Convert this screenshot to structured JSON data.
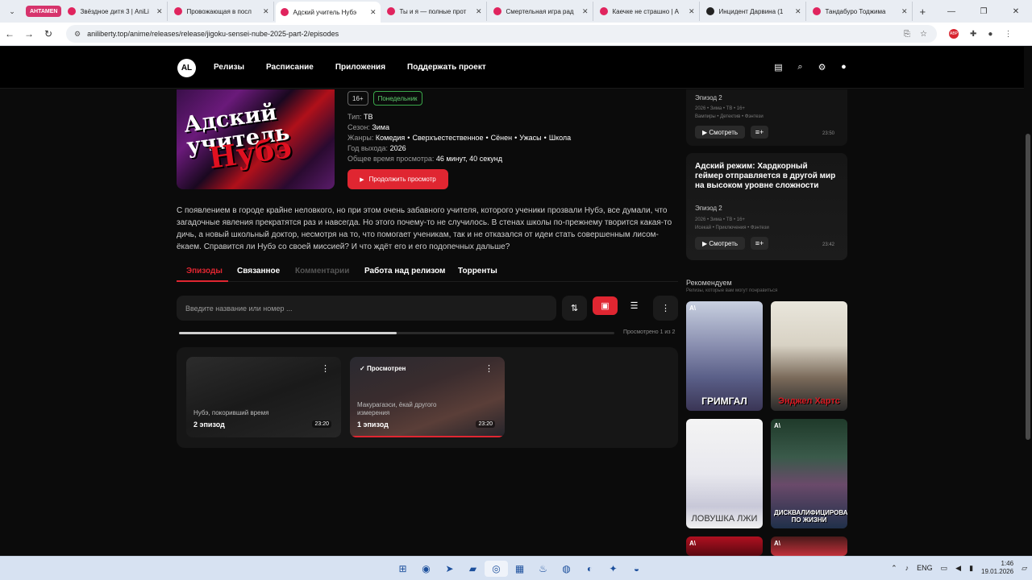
{
  "browser": {
    "group_label": "AHTAMEN",
    "tabs": [
      {
        "title": "Звёздное дитя 3 | AniLi",
        "active": false
      },
      {
        "title": "Провожающая в посл",
        "active": false
      },
      {
        "title": "Адский учитель Нубэ",
        "active": true
      },
      {
        "title": "Ты и я — полные прот",
        "active": false
      },
      {
        "title": "Смертельная игра рад",
        "active": false
      },
      {
        "title": "Каечке не страшно | А",
        "active": false
      },
      {
        "title": "Инцидент Дарвина (1",
        "active": false
      },
      {
        "title": "Тандабуро Тоджима",
        "active": false
      }
    ],
    "url": "aniliberty.top/anime/releases/release/jigoku-sensei-nube-2025-part-2/episodes"
  },
  "site": {
    "logo_text": "AL",
    "nav": [
      "Релизы",
      "Расписание",
      "Приложения",
      "Поддержать проект"
    ],
    "header_icons": [
      "collection-icon",
      "search-icon",
      "gear-icon",
      "user-icon"
    ]
  },
  "release": {
    "poster_title": "Адский учитель",
    "poster_subtitle": "Нубэ",
    "age_badge": "16+",
    "day_badge": "Понедельник",
    "type_label": "Тип:",
    "type_value": "ТВ",
    "season_label": "Сезон:",
    "season_value": "Зима",
    "genres_label": "Жанры:",
    "genres": [
      "Комедия",
      "Сверхъестественное",
      "Сёнен",
      "Ужасы",
      "Школа"
    ],
    "year_label": "Год выхода:",
    "year_value": "2026",
    "duration_label": "Общее время просмотра:",
    "duration_value": "46 минут, 40 секунд",
    "continue_label": "Продолжить просмотр",
    "description": "С появлением в городе крайне неловкого, но при этом очень забавного учителя, которого ученики прозвали Нубэ, все думали, что загадочные явления прекратятся раз и навсегда. Но этого почему-то не случилось. В стенах школы по-прежнему творится какая-то дичь, а новый школьный доктор, несмотря на то, что помогает ученикам, так и не отказался от идеи стать совершенным лисом-ёкаем. Справится ли Нубэ со своей миссией? И что ждёт его и его подопечных дальше?"
  },
  "tabs": {
    "episodes": "Эпизоды",
    "related": "Связанное",
    "comments": "Комментарии",
    "work": "Работа над релизом",
    "torrents": "Торренты"
  },
  "episodes_toolbar": {
    "search_placeholder": "Введите название или номер ...",
    "progress_text": "Просмотрено 1 из 2",
    "progress_fraction": 0.5
  },
  "episodes": [
    {
      "name": "Нубэ, покоривший время",
      "number": "2 эпизод",
      "duration": "23:20",
      "watched": false,
      "watched_label": ""
    },
    {
      "name": "Макурагаэси, ёкай другого измерения",
      "number": "1 эпизод",
      "duration": "23:20",
      "watched": true,
      "watched_label": "Просмотрен"
    }
  ],
  "sidebar": {
    "cards": [
      {
        "title": "",
        "episode": "Эпизод 2",
        "meta1": "2026 • Зима • ТВ • 16+",
        "meta2": "Вампиры • Детектив • Фэнтези",
        "watch": "Смотреть",
        "duration": "23:50"
      },
      {
        "title": "Адский режим: Хардкорный геймер отправляется в другой мир на высоком уровне сложности",
        "episode": "Эпизод 2",
        "meta1": "2026 • Зима • ТВ • 16+",
        "meta2": "Исекай • Приключения • Фэнтези",
        "watch": "Смотреть",
        "duration": "23:42"
      }
    ],
    "rec_title": "Рекомендуем",
    "rec_subtitle": "Релизы, которые вам могут понравиться",
    "recommendations": [
      {
        "name": "ГРИМГАЛ"
      },
      {
        "name": "Энджел Хартс"
      },
      {
        "name": "ЛОВУШКА ЛЖИ"
      },
      {
        "name": "ДИСКВАЛИФИЦИРОВАН ПО ЖИЗНИ"
      },
      {
        "name": ""
      },
      {
        "name": ""
      }
    ]
  },
  "taskbar": {
    "lang": "ENG",
    "time": "1:46",
    "date": "19.01.2026"
  }
}
